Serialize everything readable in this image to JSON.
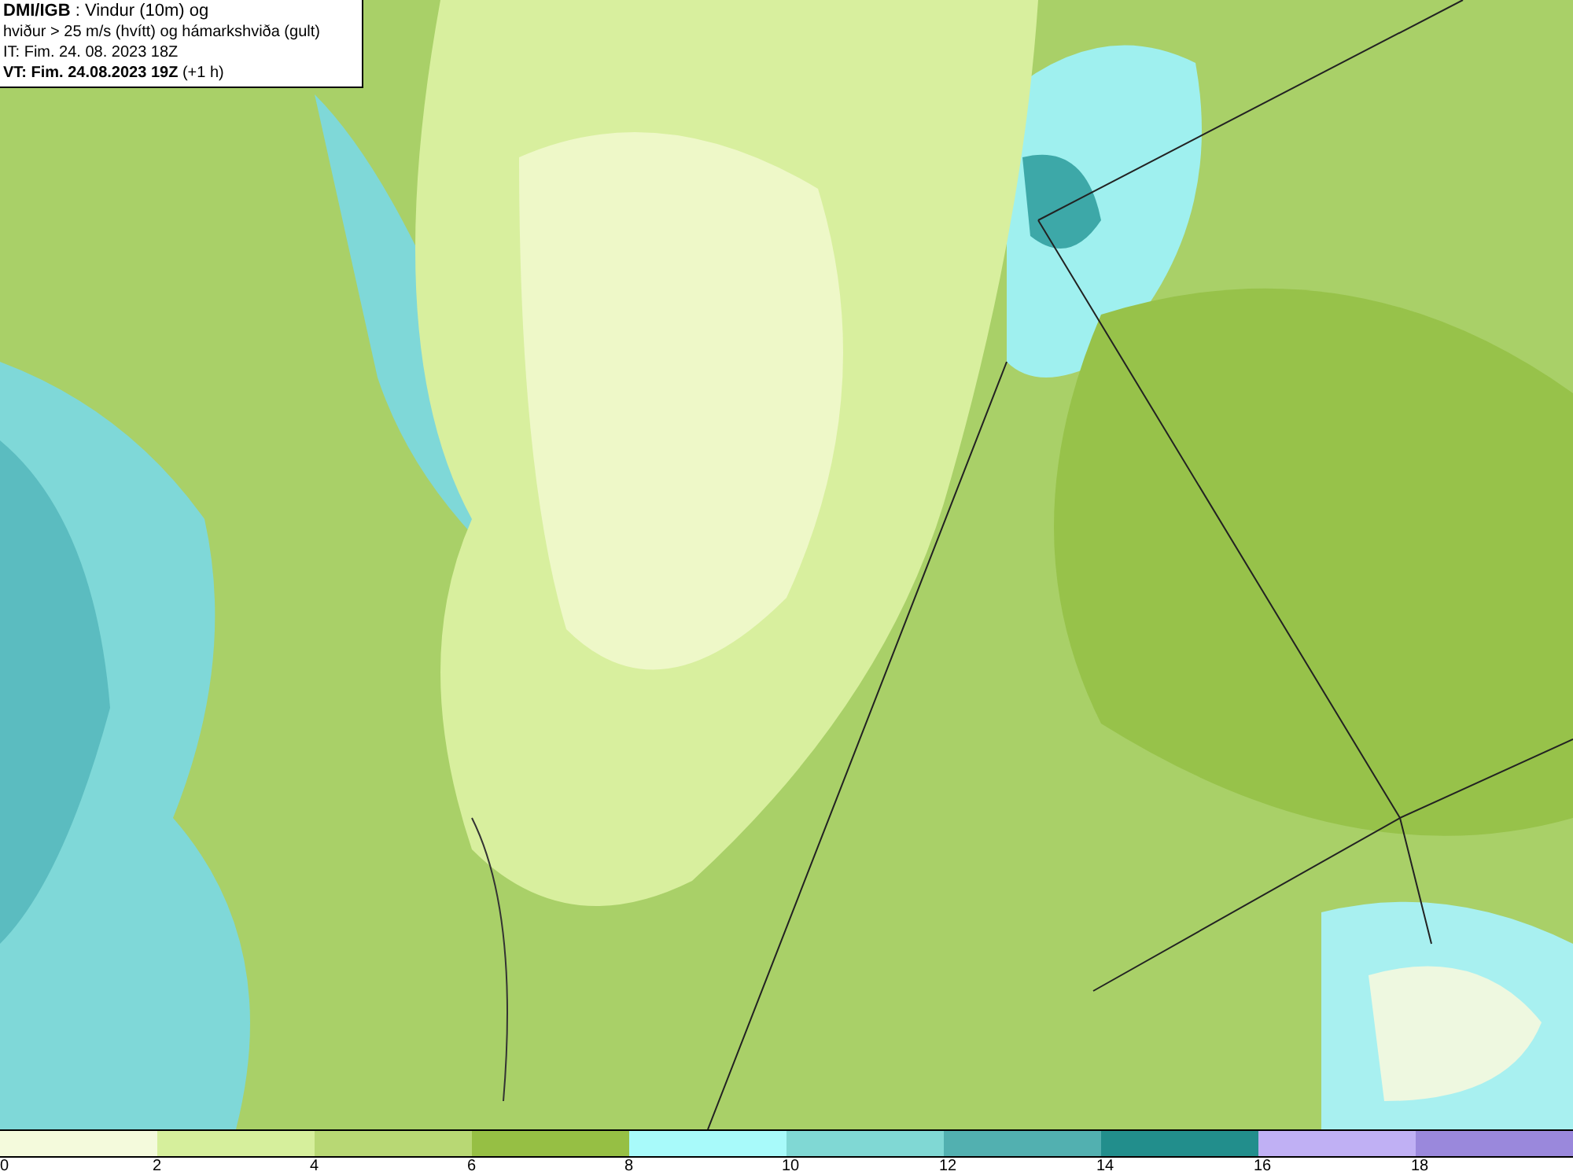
{
  "header": {
    "lines": [
      "**DMI/IGB** : Vindur (10m) og",
      "hviður > 25 m/s (hvítt) og hámarkshviða (gult)",
      "IT: Fim. 24. 08. 2023 18Z",
      "**VT: Fim. 24.08.2023 19Z** (+1 h)"
    ]
  },
  "colorbar": {
    "segments": [
      {
        "label": "0",
        "color": "#f4fadc"
      },
      {
        "label": "2",
        "color": "#d6ef9c"
      },
      {
        "label": "4",
        "color": "#b8d874"
      },
      {
        "label": "6",
        "color": "#96bf44"
      },
      {
        "label": "8",
        "color": "#a8fafa"
      },
      {
        "label": "10",
        "color": "#80d8d4"
      },
      {
        "label": "12",
        "color": "#52b0b0"
      },
      {
        "label": "14",
        "color": "#228e8c"
      },
      {
        "label": "16",
        "color": "#c0b0f4"
      },
      {
        "label": "18",
        "color": "#9a88dc"
      }
    ]
  }
}
